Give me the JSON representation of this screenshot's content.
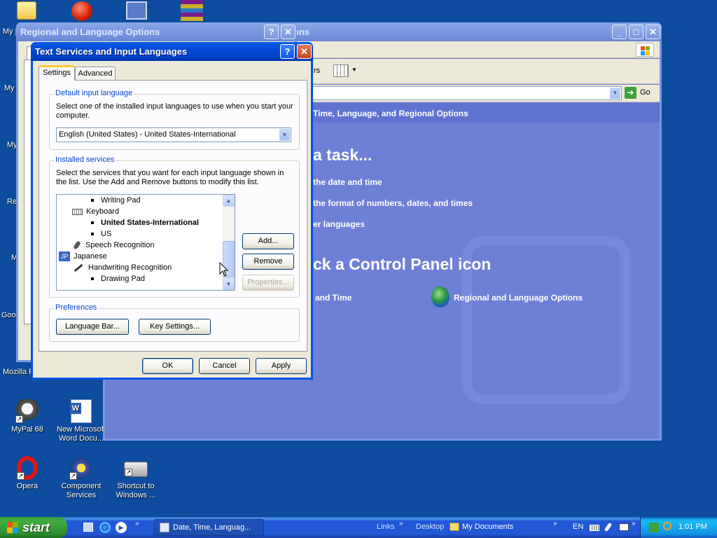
{
  "desktop": {
    "icons_left_edge": [
      "My [",
      "My",
      "My",
      "Re",
      "M",
      "Goo",
      "Mozilla F"
    ],
    "icons": [
      {
        "label": "MyPal 68"
      },
      {
        "label": "New Microsoft Word Docu..."
      },
      {
        "label": "Opera"
      },
      {
        "label": "Component Services"
      },
      {
        "label": "Shortcut to Windows ..."
      }
    ]
  },
  "control_panel": {
    "title": "ons",
    "go_label": "Go",
    "toolbar_tail": "rs",
    "breadcrumb": "Time, Language, and Regional Options",
    "pick_task": "a task...",
    "tasks": [
      "the date and time",
      "the format of numbers, dates, and times",
      "er languages"
    ],
    "pick_icon": "ck a Control Panel icon",
    "icons": [
      "and Time",
      "Regional and Language Options"
    ]
  },
  "regional_dialog": {
    "title": "Regional and Language Options"
  },
  "text_services": {
    "title": "Text Services and Input Languages",
    "tabs": [
      "Settings",
      "Advanced"
    ],
    "default_group": "Default input language",
    "default_desc": "Select one of the installed input languages to use when you start your computer.",
    "default_value": "English (United States) - United States-International",
    "installed_group": "Installed services",
    "installed_desc": "Select the services that you want for each input language shown in the list. Use the Add and Remove buttons to modify this list.",
    "tree": [
      {
        "label": "Writing Pad",
        "type": "bullet",
        "level": 2
      },
      {
        "label": "Keyboard",
        "type": "keyboard",
        "level": 1
      },
      {
        "label": "United States-International",
        "type": "bullet-bold",
        "level": 2
      },
      {
        "label": "US",
        "type": "bullet",
        "level": 2
      },
      {
        "label": "Speech Recognition",
        "type": "speech",
        "level": 1
      },
      {
        "label": "Japanese",
        "type": "lang",
        "badge": "JP",
        "level": 0
      },
      {
        "label": "Handwriting Recognition",
        "type": "pen",
        "level": 1
      },
      {
        "label": "Drawing Pad",
        "type": "bullet",
        "level": 2
      }
    ],
    "add_label": "Add...",
    "remove_label": "Remove",
    "properties_label": "Properties...",
    "preferences_group": "Preferences",
    "language_bar_label": "Language Bar...",
    "key_settings_label": "Key Settings...",
    "ok_label": "OK",
    "cancel_label": "Cancel",
    "apply_label": "Apply"
  },
  "taskbar": {
    "start_label": "start",
    "task_button": "Date, Time, Languag...",
    "links_label": "Links",
    "desktop_label": "Desktop",
    "my_documents_label": "My Documents",
    "lang_indicator": "EN",
    "clock": "1:01 PM"
  }
}
